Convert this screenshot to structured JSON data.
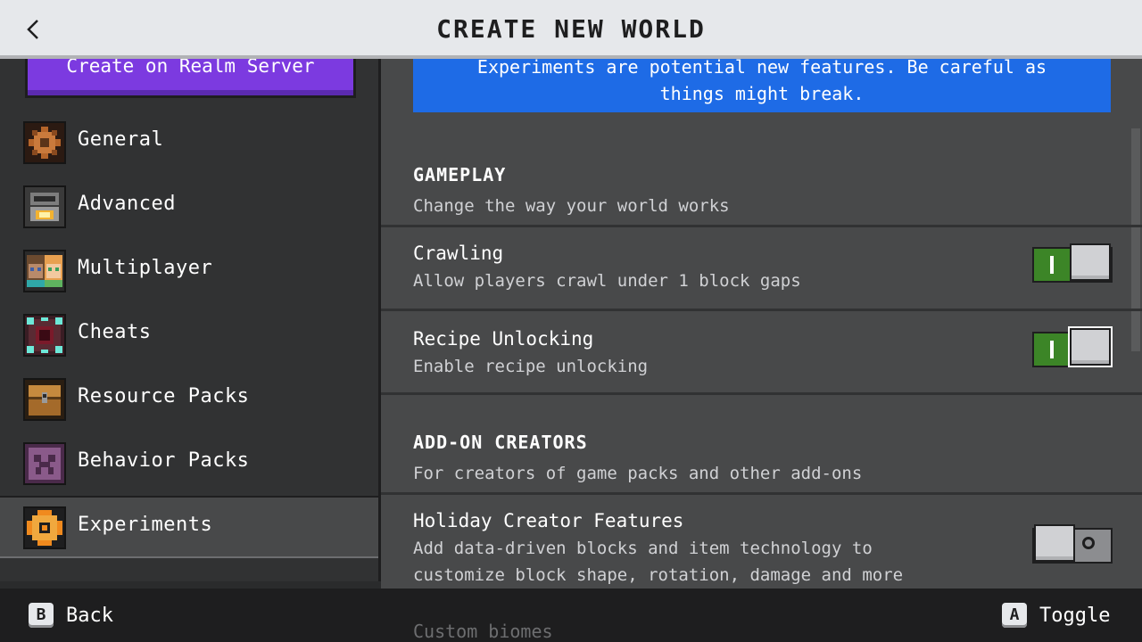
{
  "header": {
    "title": "CREATE NEW WORLD"
  },
  "sidebar": {
    "realm_button": "Create on Realm Server",
    "items": [
      {
        "label": "General",
        "icon": "gear-icon"
      },
      {
        "label": "Advanced",
        "icon": "furnace-icon"
      },
      {
        "label": "Multiplayer",
        "icon": "players-icon"
      },
      {
        "label": "Cheats",
        "icon": "command-block-icon"
      },
      {
        "label": "Resource Packs",
        "icon": "chest-icon"
      },
      {
        "label": "Behavior Packs",
        "icon": "creeper-icon"
      },
      {
        "label": "Experiments",
        "icon": "experiments-icon"
      }
    ],
    "selected": "Experiments"
  },
  "main": {
    "banner_line1": "Experiments are potential new features. Be careful as",
    "banner_line2": "things might break.",
    "sections": [
      {
        "title": "GAMEPLAY",
        "description": "Change the way your world works",
        "rows": [
          {
            "title": "Crawling",
            "description": "Allow players crawl under 1 block gaps",
            "enabled": true
          },
          {
            "title": "Recipe Unlocking",
            "description": "Enable recipe unlocking",
            "enabled": true
          }
        ]
      },
      {
        "title": "ADD-ON CREATORS",
        "description": "For creators of game packs and other add-ons",
        "rows": [
          {
            "title": "Holiday Creator Features",
            "description_line1": "Add data-driven blocks and item technology to",
            "description_line2": "customize block shape, rotation, damage and more",
            "enabled": false
          },
          {
            "title": "Custom biomes"
          }
        ]
      }
    ]
  },
  "footer": {
    "back_key": "B",
    "back_label": "Back",
    "toggle_key": "A",
    "toggle_label": "Toggle"
  },
  "colors": {
    "accent_green": "#3c8527",
    "banner_blue": "#1e6be6",
    "realm_purple": "#7c3ae0"
  }
}
